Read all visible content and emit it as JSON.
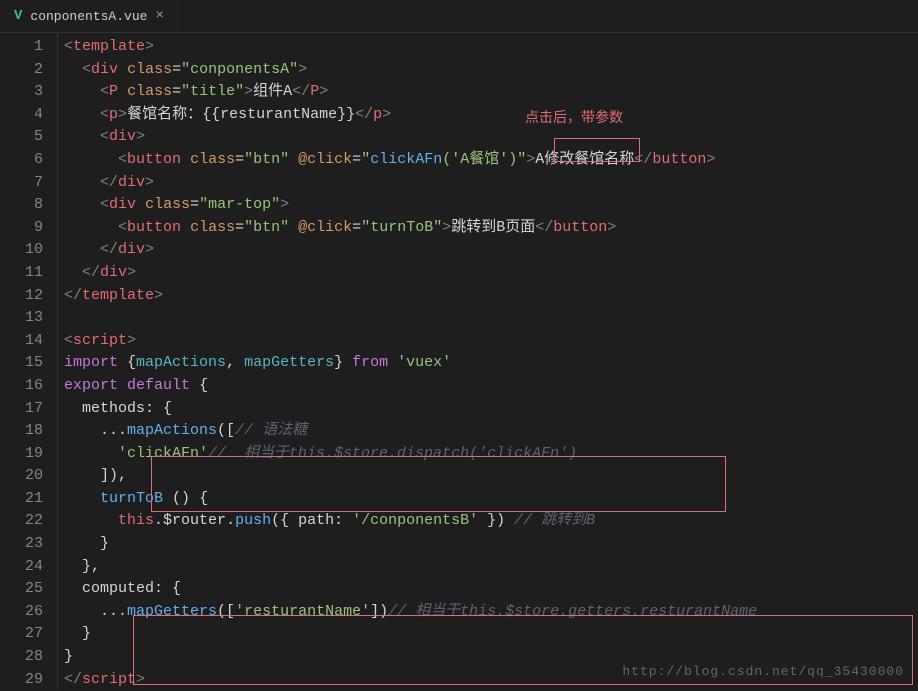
{
  "tab": {
    "filename": "conponentsA.vue",
    "close": "×"
  },
  "annotation": "点击后，带参数",
  "watermark": "http://blog.csdn.net/qq_35430000",
  "gutter": {
    "start": 1,
    "end": 29
  },
  "code": {
    "l1": {
      "open": "<",
      "tag": "template",
      "close": ">"
    },
    "l2": {
      "open": "<",
      "tag": "div",
      "attr": "class",
      "val": "conponentsA",
      "close": ">"
    },
    "l3": {
      "open": "<",
      "tag": "P",
      "attr": "class",
      "val": "title",
      "close": ">",
      "text": "组件A",
      "ctag": "P"
    },
    "l4": {
      "open": "<",
      "tag": "p",
      "close": ">",
      "text1": "餐馆名称：{{resturantName}}",
      "ctag": "p"
    },
    "l5": {
      "open": "<",
      "tag": "div",
      "close": ">"
    },
    "l6": {
      "open": "<",
      "tag": "button",
      "attr1": "class",
      "val1": "btn",
      "attr2": "@click",
      "val2": "clickAFn('A餐馆')",
      "close": ">",
      "text": "A修改餐馆名称",
      "ctag": "button"
    },
    "l7": {
      "open": "</",
      "tag": "div",
      "close": ">"
    },
    "l8": {
      "open": "<",
      "tag": "div",
      "attr": "class",
      "val": "mar-top",
      "close": ">"
    },
    "l9": {
      "open": "<",
      "tag": "button",
      "attr1": "class",
      "val1": "btn",
      "attr2": "@click",
      "val2": "turnToB",
      "close": ">",
      "text": "跳转到B页面",
      "ctag": "button"
    },
    "l10": {
      "open": "</",
      "tag": "div",
      "close": ">"
    },
    "l11": {
      "open": "</",
      "tag": "div",
      "close": ">"
    },
    "l12": {
      "open": "</",
      "tag": "template",
      "close": ">"
    },
    "l14": {
      "open": "<",
      "tag": "script",
      "close": ">"
    },
    "l15": {
      "kw": "import",
      "brace1": "{",
      "id1": "mapActions",
      "comma": ",",
      "id2": "mapGetters",
      "brace2": "}",
      "from": "from",
      "mod": "'vuex'"
    },
    "l16": {
      "kw1": "export",
      "kw2": "default",
      "brace": "{"
    },
    "l17": {
      "key": "methods:",
      "brace": "{"
    },
    "l18": {
      "spread": "...",
      "fn": "mapActions",
      "paren": "([",
      "comment": "// 语法糖"
    },
    "l19": {
      "str": "'clickAFn'",
      "comment": "//  相当于this.$store.dispatch('clickAFn')"
    },
    "l20": {
      "close": "]),"
    },
    "l21": {
      "fn": "turnToB",
      "paren": "()",
      "brace": "{"
    },
    "l22": {
      "this": "this",
      "dot1": ".",
      "prop": "$router",
      "dot2": ".",
      "method": "push",
      "args": "({ path: ",
      "str": "'/conponentsB'",
      "args2": " })",
      "comment": " // 跳转到B"
    },
    "l23": {
      "close": "}"
    },
    "l24": {
      "close": "},"
    },
    "l25": {
      "key": "computed:",
      "brace": "{"
    },
    "l26": {
      "spread": "...",
      "fn": "mapGetters",
      "paren": "([",
      "str": "'resturantName'",
      "paren2": "])",
      "comment": "// 相当于this.$store.getters.resturantName"
    },
    "l27": {
      "close": "}"
    },
    "l28": {
      "close": "}"
    },
    "l29": {
      "open": "</",
      "tag": "script",
      "close": ">"
    }
  }
}
